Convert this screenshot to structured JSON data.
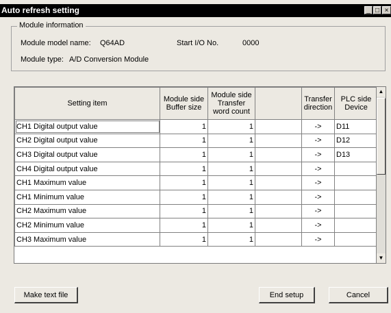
{
  "window": {
    "title": "Auto refresh setting",
    "min_glyph": "_",
    "max_glyph": "□",
    "close_glyph": "×"
  },
  "module_info": {
    "legend": "Module information",
    "model_label": "Module model name:",
    "model_value": "Q64AD",
    "io_label": "Start I/O No.",
    "io_value": "0000",
    "type_label": "Module type:",
    "type_value": "A/D Conversion Module"
  },
  "table": {
    "headers": [
      "Setting item",
      "Module side Buffer size",
      "Module side Transfer word count",
      "",
      "Transfer direction",
      "PLC side Device"
    ],
    "rows": [
      {
        "item": "CH1 Digital output value",
        "buffer": "1",
        "word": "1",
        "blank": "",
        "dir": "->",
        "device": "D11"
      },
      {
        "item": "CH2 Digital output value",
        "buffer": "1",
        "word": "1",
        "blank": "",
        "dir": "->",
        "device": "D12"
      },
      {
        "item": "CH3 Digital output value",
        "buffer": "1",
        "word": "1",
        "blank": "",
        "dir": "->",
        "device": "D13"
      },
      {
        "item": "CH4 Digital output value",
        "buffer": "1",
        "word": "1",
        "blank": "",
        "dir": "->",
        "device": ""
      },
      {
        "item": "CH1 Maximum value",
        "buffer": "1",
        "word": "1",
        "blank": "",
        "dir": "->",
        "device": ""
      },
      {
        "item": "CH1 Minimum value",
        "buffer": "1",
        "word": "1",
        "blank": "",
        "dir": "->",
        "device": ""
      },
      {
        "item": "CH2 Maximum value",
        "buffer": "1",
        "word": "1",
        "blank": "",
        "dir": "->",
        "device": ""
      },
      {
        "item": "CH2 Minimum value",
        "buffer": "1",
        "word": "1",
        "blank": "",
        "dir": "->",
        "device": ""
      },
      {
        "item": "CH3 Maximum value",
        "buffer": "1",
        "word": "1",
        "blank": "",
        "dir": "->",
        "device": ""
      }
    ]
  },
  "scrollbar": {
    "up_glyph": "▲",
    "down_glyph": "▼"
  },
  "buttons": {
    "make_text": "Make text file",
    "end_setup": "End setup",
    "cancel": "Cancel"
  }
}
